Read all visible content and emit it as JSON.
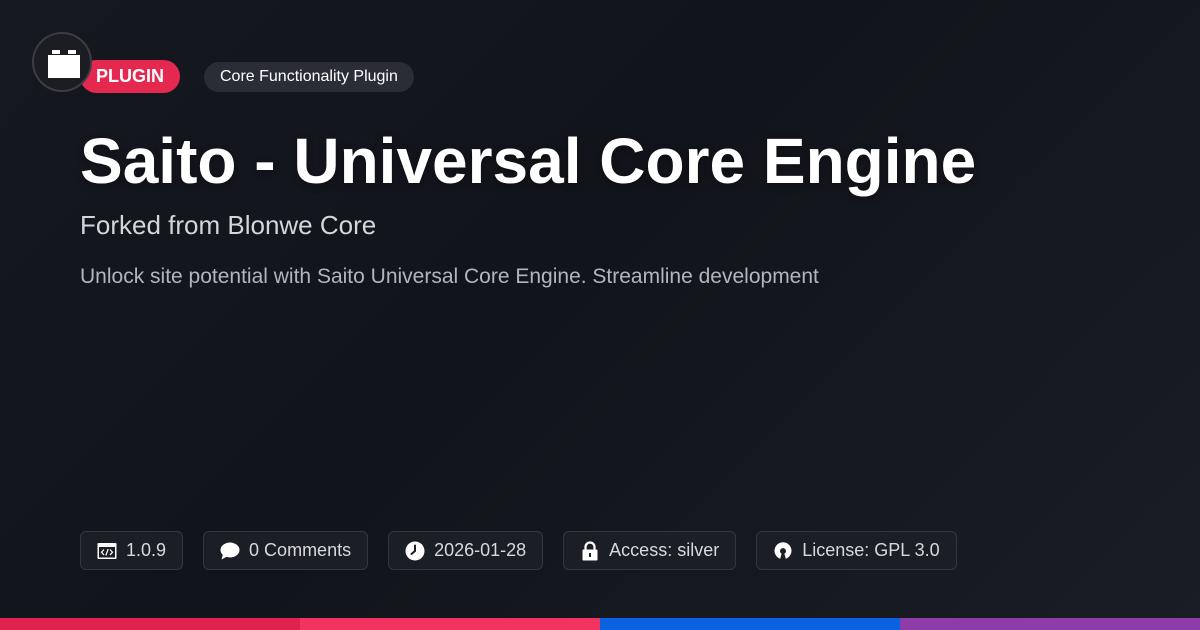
{
  "logo": {
    "icon": "plugin-block-icon"
  },
  "badges": {
    "type": "PLUGIN",
    "category": "Core Functionality Plugin"
  },
  "title": "Saito - Universal Core Engine",
  "subtitle": "Forked from Blonwe Core",
  "description": "Unlock site potential with Saito Universal Core Engine. Streamline development",
  "meta": {
    "version": "1.0.9",
    "comments": "0 Comments",
    "date": "2026-01-28",
    "access": "Access: silver",
    "license": "License: GPL 3.0"
  },
  "colors": {
    "accent": "#e5284f",
    "bar": [
      "#e0224f",
      "#f2335f",
      "#0a62e0",
      "#8e3da8"
    ]
  }
}
